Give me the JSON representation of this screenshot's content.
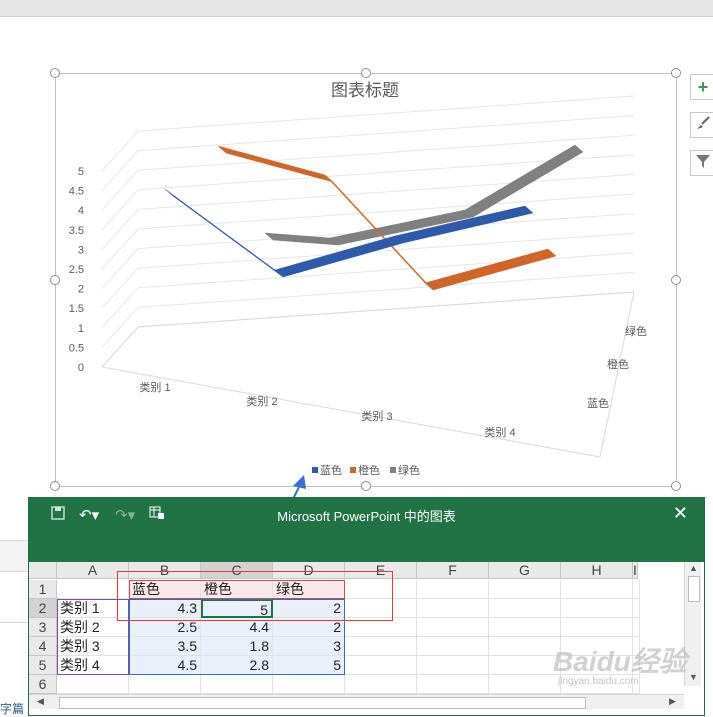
{
  "chart": {
    "title": "图表标题",
    "buttons": [
      {
        "name": "chart-elements-button",
        "icon": "plus-icon",
        "glyph": "+"
      },
      {
        "name": "chart-styles-button",
        "icon": "brush-icon",
        "glyph": "🖌"
      },
      {
        "name": "chart-filters-button",
        "icon": "filter-icon",
        "glyph": "▼"
      }
    ],
    "colors": {
      "blue": "#2e5aa8",
      "orange": "#d0652a",
      "gray": "#808080"
    }
  },
  "chart_data": {
    "type": "line",
    "style": "3d",
    "title": "图表标题",
    "categories": [
      "类别 1",
      "类别 2",
      "类别 3",
      "类别 4"
    ],
    "series": [
      {
        "name": "蓝色",
        "values": [
          4.3,
          2.5,
          3.5,
          4.5
        ],
        "color": "#2e5aa8"
      },
      {
        "name": "橙色",
        "values": [
          5,
          4.4,
          1.8,
          2.8
        ],
        "color": "#d0652a"
      },
      {
        "name": "绿色",
        "values": [
          2,
          2,
          3,
          5
        ],
        "color": "#808080"
      }
    ],
    "yticks": [
      "0",
      "0.5",
      "1",
      "1.5",
      "2",
      "2.5",
      "3",
      "3.5",
      "4",
      "4.5",
      "5"
    ],
    "depth_labels": [
      "绿色",
      "橙色",
      "蓝色"
    ],
    "ylim": [
      0,
      5
    ],
    "grid": true,
    "legend_position": "bottom"
  },
  "excel": {
    "window_title": "Microsoft PowerPoint 中的图表",
    "close_glyph": "✕",
    "columns": [
      "A",
      "B",
      "C",
      "D",
      "E",
      "F",
      "G",
      "H",
      "I"
    ],
    "rows": [
      "1",
      "2",
      "3",
      "4",
      "5",
      "6"
    ],
    "header_row": [
      "",
      "蓝色",
      "橙色",
      "绿色"
    ],
    "data_rows": [
      [
        "类别 1",
        "4.3",
        "5",
        "2"
      ],
      [
        "类别 2",
        "2.5",
        "4.4",
        "2"
      ],
      [
        "类别 3",
        "3.5",
        "1.8",
        "3"
      ],
      [
        "类别 4",
        "4.5",
        "2.8",
        "5"
      ]
    ]
  },
  "side_text": "字篇",
  "watermark": {
    "main": "Baidu经验",
    "sub": "jingyan.baidu.com"
  }
}
